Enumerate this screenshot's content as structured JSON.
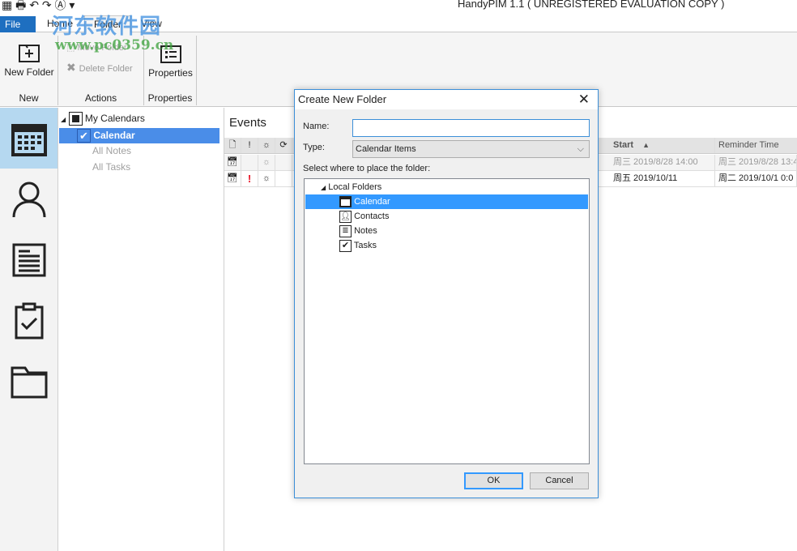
{
  "window": {
    "title": "HandyPIM 1.1 ( UNREGISTERED EVALUATION COPY )"
  },
  "watermark": {
    "text": "河东软件园",
    "url": "www.pc0359.cn"
  },
  "ribbon": {
    "tabs": [
      {
        "label": "File"
      },
      {
        "label": "Home"
      },
      {
        "label": "Folder"
      },
      {
        "label": "View"
      }
    ],
    "active_tab": "Folder",
    "groups": [
      {
        "label": "New",
        "buttons": [
          {
            "label": "New Folder",
            "enabled": true
          }
        ]
      },
      {
        "label": "Actions",
        "buttons": [
          {
            "label": "Move Folder",
            "enabled": false
          },
          {
            "label": "Delete Folder",
            "enabled": false
          }
        ]
      },
      {
        "label": "Properties",
        "buttons": [
          {
            "label": "Properties",
            "enabled": true
          }
        ]
      }
    ]
  },
  "nav": {
    "items": [
      "calendar-icon",
      "contacts-icon",
      "notes-icon",
      "tasks-icon",
      "folder-icon"
    ],
    "active": "calendar"
  },
  "folder_tree": {
    "root": "My Calendars",
    "items": [
      {
        "label": "Calendar",
        "selected": true
      },
      {
        "label": "All Notes"
      },
      {
        "label": "All Tasks"
      }
    ]
  },
  "events": {
    "title": "Events",
    "columns": {
      "start": "Start",
      "reminder": "Reminder Time"
    },
    "rows": [
      {
        "important": false,
        "reminder": true,
        "start": "周三 2019/8/28 14:00",
        "reminder_time": "周三 2019/8/28 13:4",
        "dimmed": true
      },
      {
        "important": true,
        "reminder": true,
        "start": "周五 2019/10/11",
        "reminder_time": "周二 2019/10/1 0:0",
        "dimmed": false
      }
    ]
  },
  "dialog": {
    "title": "Create New Folder",
    "name_label": "Name:",
    "name_value": "",
    "type_label": "Type:",
    "type_value": "Calendar Items",
    "place_label": "Select where to place the folder:",
    "tree_root": "Local Folders",
    "tree_items": [
      {
        "label": "Calendar",
        "icon": "calendar-icon",
        "selected": true
      },
      {
        "label": "Contacts",
        "icon": "contact-icon"
      },
      {
        "label": "Notes",
        "icon": "notes-icon"
      },
      {
        "label": "Tasks",
        "icon": "tasks-icon"
      }
    ],
    "ok": "OK",
    "cancel": "Cancel"
  },
  "colors": {
    "accent": "#3399ff",
    "nav_active": "#b5d8f0",
    "tree_selected": "#4a8de8",
    "important": "#e81123"
  }
}
